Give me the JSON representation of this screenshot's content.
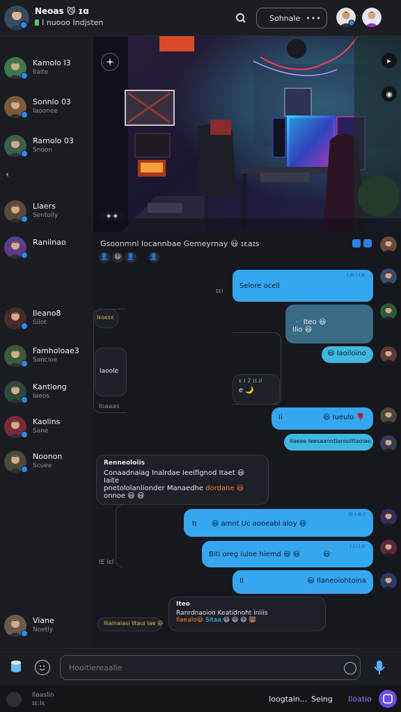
{
  "header": {
    "name": "Neoas 😼 ɪɑ",
    "status": "I nuooo Indjsten",
    "scene_label": "Sohnale",
    "more": "•••"
  },
  "sidebar": {
    "contacts": [
      {
        "name": "Kamolo I3",
        "sub": "Ilaite",
        "color": "#3b7a4a"
      },
      {
        "name": "Sonnlo 03",
        "sub": "Iaoonee",
        "color": "#7a5b3b"
      },
      {
        "name": "Ramolo 03",
        "sub": "Snoon",
        "color": "#3b5f4f"
      },
      {
        "name": "Llaers",
        "sub": "Sentolly",
        "color": "#5a4a3a"
      },
      {
        "name": "Ranilnao",
        "sub": "",
        "color": "#5b3b8a"
      },
      {
        "name": "Ileano8",
        "sub": "Silot",
        "color": "#4a2a2a"
      },
      {
        "name": "Famholoae3",
        "sub": "Sancioe",
        "color": "#3a5a3a"
      },
      {
        "name": "Kantlong",
        "sub": "Iaeos",
        "color": "#2a4a3a"
      },
      {
        "name": "Kaolins",
        "sub": "Sane",
        "color": "#7a2a3a"
      },
      {
        "name": "Noonon",
        "sub": "Scuee",
        "color": "#4a4a3a"
      },
      {
        "name": "Viane",
        "sub": "Noetly",
        "color": "#6a5a4a"
      }
    ],
    "collapse": "‹"
  },
  "media": {
    "tool": "◈ ◈",
    "side_icons": [
      "▸",
      "◉"
    ]
  },
  "caption": {
    "text": "Gsoonmnl Iocannbae Gemeyrnay 😃 ɪɛaɪs"
  },
  "messages": {
    "m1": {
      "text": "Selore ocell",
      "time": "I.III I.I.II"
    },
    "m1_tick": "ɪɛi",
    "m2_line1": "🔹 Iteo 😃",
    "m2_line2": "Ilio 😃",
    "left1": "Iɛoɛɛɛ",
    "left2": "Iaoole",
    "left3": "Ioaaas",
    "m3": "😃 Iaoiloino",
    "m4_time": "ɛ  ɪ  2 ɪɪ.ɪl",
    "m4_icons": "e 🌙",
    "m5": {
      "a": "Ii",
      "b": "😃 Iueulo 🌹"
    },
    "m6": "Ilaeae  Ieesaanntianisilitaoiae",
    "long": {
      "title": "Renneoloiis",
      "line1": "Conaadnaiag Inalrdae Ieeifignod Itaet 😃 Iaite",
      "line2": "pnetololanlionder Manaedhe",
      "line2_highlight": "dordane 😃",
      "line3": "onnoe 😃 😃"
    },
    "m7": {
      "a": "Iɪ",
      "b": "😃 amnt  Uc aooeabl aloy 😃",
      "time": "III I III.I"
    },
    "m8": {
      "a": "Biti  oreg iuloe  hiemd  😃 😃",
      "b": "😃",
      "time": "I.I.I.I.II"
    },
    "m9": {
      "a": "II",
      "b": "😃 Ilaneoiohtoina"
    },
    "left_ts": "IE IɛI",
    "long2": {
      "title": "Iteo",
      "line1": "Ranrdnaoioo Keatidnoht iniiis",
      "line2a": "Ilaealo😃 ",
      "line2b": "Sitaa",
      "line2c": "  😃  😃  😃   🐻"
    },
    "left_line": "Ilialnaiasi Iltaui Iae 😃"
  },
  "composer": {
    "placeholder": "Hooitiereaalle"
  },
  "bottom": {
    "l1": "Iloaslin",
    "l2": "ɪɛ:Iɛ",
    "t1": "Ioogtain...",
    "t2": "Seing",
    "t3": "Iloatio"
  },
  "colors": {
    "bubble_blue": "#35a6f0",
    "bubble_teal": "#3fb8e0",
    "accent": "#6b4de6",
    "background": "#16181d"
  }
}
